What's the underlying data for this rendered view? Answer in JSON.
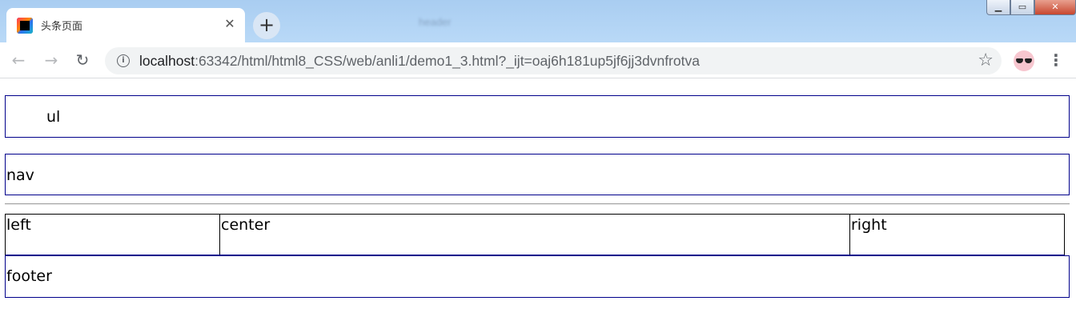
{
  "browser": {
    "tab": {
      "title": "头条页面"
    },
    "url": {
      "host": "localhost",
      "rest": ":63342/html/html8_CSS/web/anli1/demo1_3.html?_ijt=oaj6h181up5jf6jj3dvnfrotva"
    },
    "background_ghost_text": "header",
    "icons": {
      "favicon": "intellij-favicon-icon",
      "close_tab": "close-icon",
      "new_tab": "plus-icon",
      "back": "arrow-left-icon",
      "forward": "arrow-right-icon",
      "reload": "reload-icon",
      "site_info": "info-icon",
      "bookmark": "star-icon",
      "profile": "profile-avatar-icon",
      "menu": "kebab-menu-icon",
      "window_minimize": "minimize-icon",
      "window_maximize": "maximize-icon",
      "window_close": "close-window-icon"
    }
  },
  "page": {
    "ul_label": "ul",
    "nav_label": "nav",
    "content": {
      "left_label": "left",
      "center_label": "center",
      "right_label": "right"
    },
    "footer_label": "footer"
  },
  "colors": {
    "box_border": "#00008b",
    "tabstrip": "#b9d9f7",
    "omnibox": "#f1f3f4"
  }
}
